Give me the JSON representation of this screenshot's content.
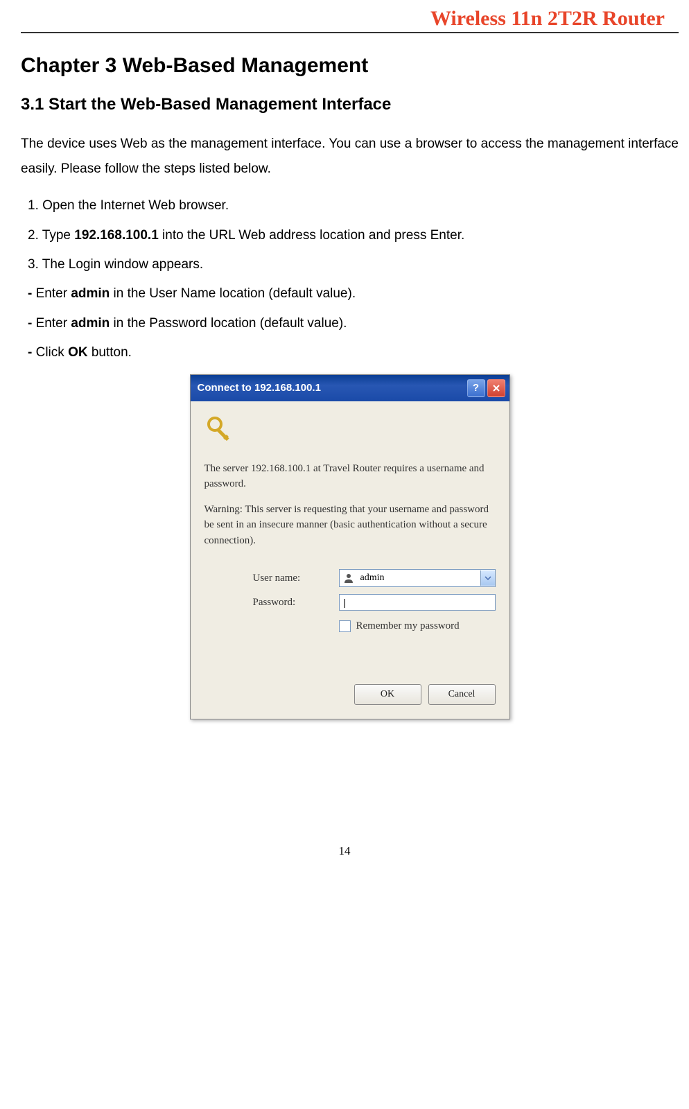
{
  "header": {
    "title": "Wireless 11n 2T2R Router"
  },
  "chapter": {
    "title": "Chapter 3  Web-Based Management"
  },
  "section": {
    "title": "3.1    Start the Web-Based Management Interface"
  },
  "intro": "The device uses Web as the management interface. You can use a browser to access the management interface easily. Please follow the steps listed below.",
  "steps": {
    "s1": "1. Open the Internet Web browser.",
    "s2_pre": "2. Type ",
    "s2_bold": "192.168.100.1",
    "s2_post": " into the URL Web address location and press Enter.",
    "s3": "3. The Login window appears.",
    "s4_pre": "- ",
    "s4_mid": "Enter ",
    "s4_bold": "admin",
    "s4_post": " in the User Name location (default value).",
    "s5_pre": "- ",
    "s5_mid": "Enter ",
    "s5_bold": "admin",
    "s5_post": " in the Password location (default value).",
    "s6_pre": "- ",
    "s6_mid": "Click ",
    "s6_bold": "OK",
    "s6_post": " button."
  },
  "dialog": {
    "title": "Connect to 192.168.100.1",
    "msg1": "The server 192.168.100.1 at Travel Router requires a username and password.",
    "msg2": "Warning: This server is requesting that your username and password be sent in an insecure manner (basic authentication without a secure connection).",
    "username_label": "User name:",
    "password_label": "Password:",
    "username_value": "admin",
    "password_value": "|",
    "remember_label": "Remember my password",
    "ok_button": "OK",
    "cancel_button": "Cancel"
  },
  "page_number": "14"
}
